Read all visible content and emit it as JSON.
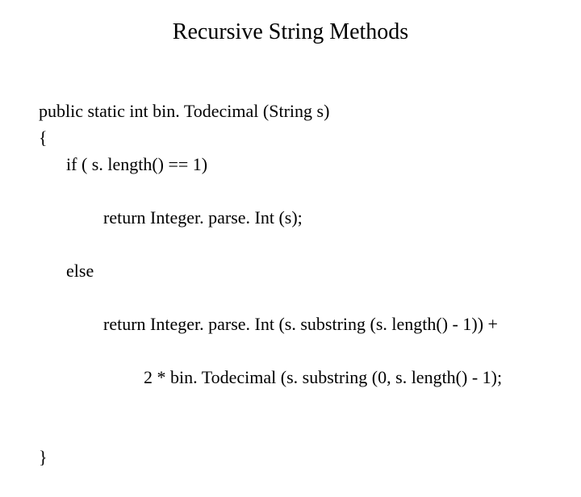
{
  "title": "Recursive String Methods",
  "code": {
    "l1": "public static int bin. Todecimal (String s)",
    "l2": "{",
    "l3": "if ( s. length() == 1)",
    "l4": "return Integer. parse. Int (s);",
    "l5": "else",
    "l6": "return Integer. parse. Int (s. substring (s. length() - 1)) +",
    "l7": "2 * bin. Todecimal (s. substring (0, s. length() - 1);",
    "l8": "}"
  }
}
